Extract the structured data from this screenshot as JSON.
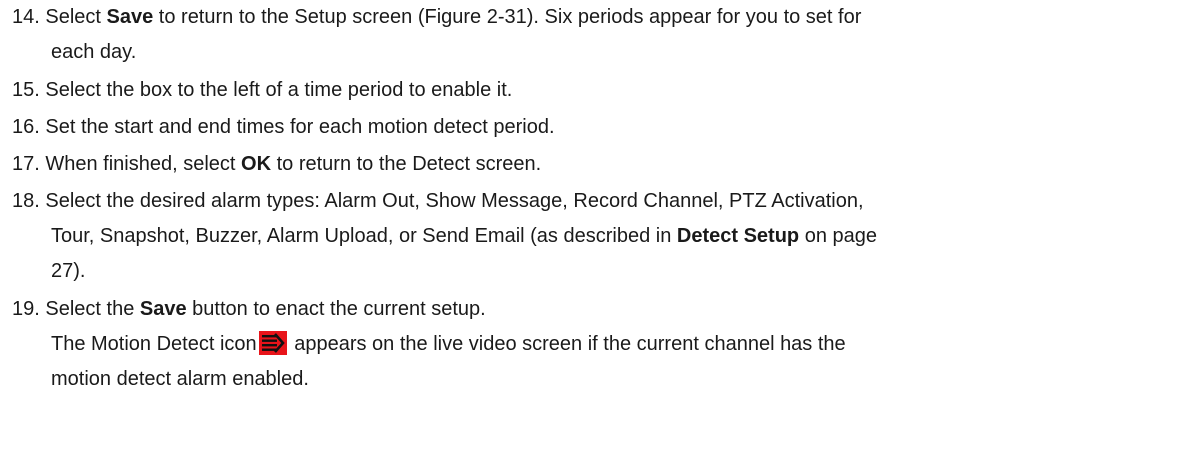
{
  "steps": [
    {
      "number": "14.",
      "before": " Select ",
      "bold": "Save",
      "after": " to return to the Setup screen (Figure 2-31). Six periods appear for you to set for",
      "cont": "each day."
    },
    {
      "number": "15.",
      "text": " Select the box to the left of a time period to enable it."
    },
    {
      "number": "16.",
      "text": " Set the start and end times for each motion detect period."
    },
    {
      "number": "17.",
      "before": " When finished, select ",
      "bold": "OK",
      "after": " to return to the Detect screen."
    },
    {
      "number": "18.",
      "text": " Select the desired alarm types: Alarm Out, Show Message, Record Channel, PTZ Activation,",
      "cont_before": "Tour, Snapshot, Buzzer, Alarm Upload, or Send Email (as described in ",
      "cont_bold": "Detect Setup",
      "cont_after": " on page",
      "cont2": "27)."
    },
    {
      "number": "19.",
      "before": " Select the ",
      "bold": "Save",
      "after": " button to enact the current setup.",
      "note_before": "The Motion Detect icon",
      "note_after": " appears on the live video screen if the current channel has the",
      "note_cont": "motion detect alarm enabled."
    }
  ],
  "icon": {
    "name": "motion-detect-icon",
    "color": "#e8141a"
  }
}
